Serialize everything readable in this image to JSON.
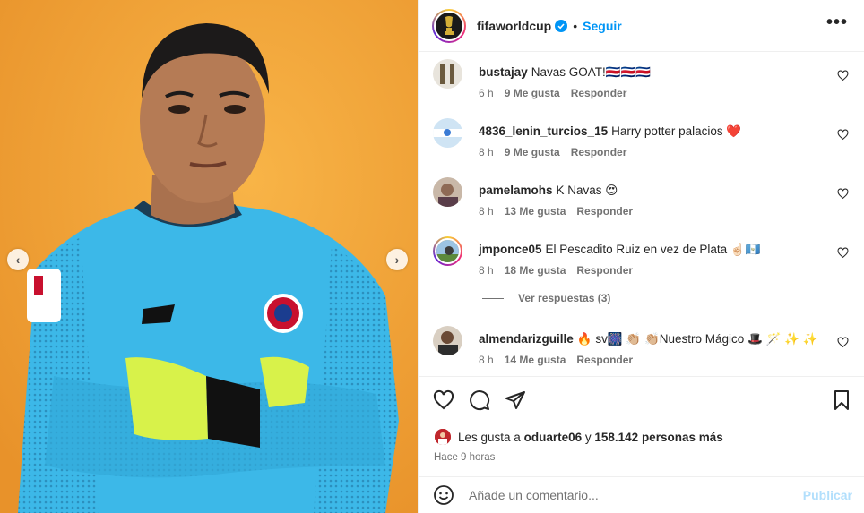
{
  "header": {
    "username": "fifaworldcup",
    "separator": "•",
    "follow_label": "Seguir",
    "more_label": "•••"
  },
  "media": {
    "prev_label": "‹",
    "next_label": "›",
    "dot_count": 10,
    "active_dot": 4
  },
  "comments": [
    {
      "user": "bustajay",
      "text": "Navas GOAT!🇨🇷🇨🇷🇨🇷",
      "time": "6 h",
      "likes": "9 Me gusta",
      "reply": "Responder"
    },
    {
      "user": "4836_lenin_turcios_15",
      "text": "Harry potter palacios ❤️",
      "time": "8 h",
      "likes": "9 Me gusta",
      "reply": "Responder"
    },
    {
      "user": "pamelamohs",
      "text": "K Navas 😍",
      "time": "8 h",
      "likes": "13 Me gusta",
      "reply": "Responder"
    },
    {
      "user": "jmponce05",
      "text": "El Pescadito Ruiz en vez de Plata ☝🏻🇬🇹",
      "time": "8 h",
      "likes": "18 Me gusta",
      "reply": "Responder"
    },
    {
      "user": "almendarizguille",
      "text": "🔥 sv🎆 👏🏼 👏🏼Nuestro Mágico 🎩 🪄 ✨ ✨",
      "time": "8 h",
      "likes": "14 Me gusta",
      "reply": "Responder"
    }
  ],
  "view_replies": "Ver respuestas (3)",
  "likes": {
    "prefix": "Les gusta a",
    "user": "oduarte06",
    "conj": "y",
    "others": "158.142 personas más"
  },
  "time_ago": "Hace 9 horas",
  "add_comment": {
    "placeholder": "Añade un comentario...",
    "publish_label": "Publicar"
  },
  "colors": {
    "accent": "#0095f6",
    "media_bg": "#f4a73b",
    "jersey": "#3cb8e8"
  }
}
